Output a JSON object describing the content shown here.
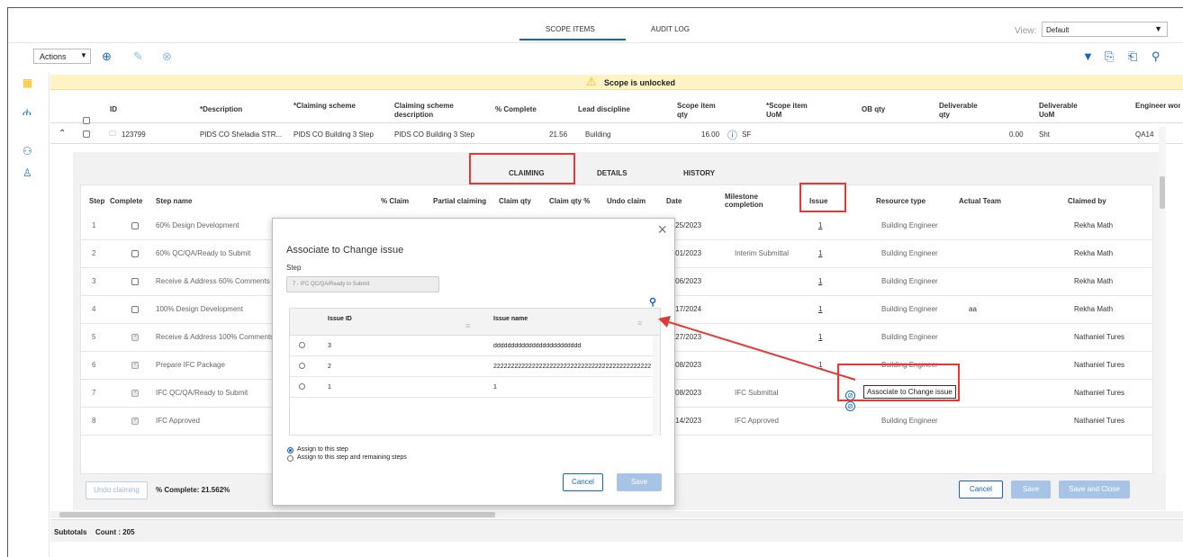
{
  "top_tabs": {
    "scope_items": "SCOPE ITEMS",
    "audit_log": "AUDIT LOG"
  },
  "view": {
    "label": "View:",
    "value": "Default"
  },
  "toolbar": {
    "actions": "Actions"
  },
  "banner": {
    "text": "Scope is unlocked"
  },
  "columns": [
    "ID",
    "*Description",
    "*Claiming scheme",
    "Claiming scheme description",
    "% Complete",
    "Lead discipline",
    "Scope item qty",
    "*Scope item UoM",
    "OB qty",
    "Deliverable qty",
    "Deliverable UoM",
    "Engineer work pa"
  ],
  "row": {
    "id": "123799",
    "description": "PIDS CO Sheladia STR...",
    "scheme": "PIDS CO Building 3 Step",
    "scheme_desc": "PIDS CO Building 3 Step",
    "complete": "21.56",
    "lead": "Building",
    "qty": "16.00",
    "uom": "SF",
    "deliv_qty": "0.00",
    "deliv_uom": "Sht",
    "eng": "QA14"
  },
  "sub_tabs": {
    "claiming": "CLAIMING",
    "details": "DETAILS",
    "history": "HISTORY"
  },
  "step_columns": [
    "Step",
    "Complete",
    "Step name",
    "% Claim",
    "Partial claiming",
    "Claim qty",
    "Claim qty %",
    "Undo claim",
    "Date",
    "Milestone completion",
    "Issue",
    "Resource type",
    "Actual Team",
    "Claimed by"
  ],
  "steps": [
    {
      "n": "1",
      "checked": false,
      "name": "60% Design Development",
      "date": "02/25/2023",
      "milestone": "",
      "issue": "1",
      "resource": "Building Engineer",
      "team": "",
      "by": "Rekha Math"
    },
    {
      "n": "2",
      "checked": false,
      "name": "60% QC/QA/Ready to Submit",
      "date": "04/01/2023",
      "milestone": "Interim Submittal",
      "issue": "1",
      "resource": "Building Engineer",
      "team": "",
      "by": "Rekha Math"
    },
    {
      "n": "3",
      "checked": false,
      "name": "Receive & Address 60% Comments",
      "date": "05/06/2023",
      "milestone": "",
      "issue": "1",
      "resource": "Building Engineer",
      "team": "",
      "by": "Rekha Math"
    },
    {
      "n": "4",
      "checked": false,
      "name": "100% Design Development",
      "date": "10/17/2024",
      "milestone": "",
      "issue": "1",
      "resource": "Building Engineer",
      "team": "aa",
      "by": "Rekha Math"
    },
    {
      "n": "5",
      "checked": true,
      "name": "Receive & Address 100% Comments",
      "date": "06/27/2023",
      "milestone": "",
      "issue": "1",
      "resource": "Building Engineer",
      "team": "",
      "by": "Nathaniel Tures"
    },
    {
      "n": "6",
      "checked": true,
      "name": "Prepare IFC Package",
      "date": "07/08/2023",
      "milestone": "",
      "issue": "1",
      "resource": "Building Engineer",
      "team": "",
      "by": "Nathaniel Tures"
    },
    {
      "n": "7",
      "checked": true,
      "name": "IFC QC/QA/Ready to Submit",
      "date": "07/08/2023",
      "milestone": "IFC Submittal",
      "issue": "",
      "resource": "Building Engineer",
      "team": "",
      "by": "Nathaniel Tures"
    },
    {
      "n": "8",
      "checked": true,
      "name": "IFC Approved",
      "date": "10/14/2023",
      "milestone": "IFC Approved",
      "issue": "",
      "resource": "Building Engineer",
      "team": "",
      "by": "Nathaniel Tures"
    }
  ],
  "tooltip": "Associate to Change issue",
  "footer": {
    "undo": "Undo claiming",
    "complete": "% Complete: 21.562%",
    "cancel": "Cancel",
    "save": "Save",
    "save_close": "Save and Close"
  },
  "subtotals": {
    "label": "Subtotals",
    "count": "Count : 205"
  },
  "modal": {
    "title": "Associate to Change issue",
    "step_label": "Step",
    "step_value": "7 - IFC QC/QA/Ready to Submit",
    "col_id": "Issue ID",
    "col_name": "Issue name",
    "issues": [
      {
        "id": "3",
        "name": "ddddddddddddddddddddddddd"
      },
      {
        "id": "2",
        "name": "2222222222222222222222222222222222222222222222..."
      },
      {
        "id": "1",
        "name": "1"
      }
    ],
    "opt1": "Assign to this step",
    "opt2": "Assign to this step and remaining steps",
    "cancel": "Cancel",
    "save": "Save"
  },
  "colors": {
    "accent": "#1565c0",
    "annotation": "#e53935",
    "banner": "#fdf3c4"
  }
}
